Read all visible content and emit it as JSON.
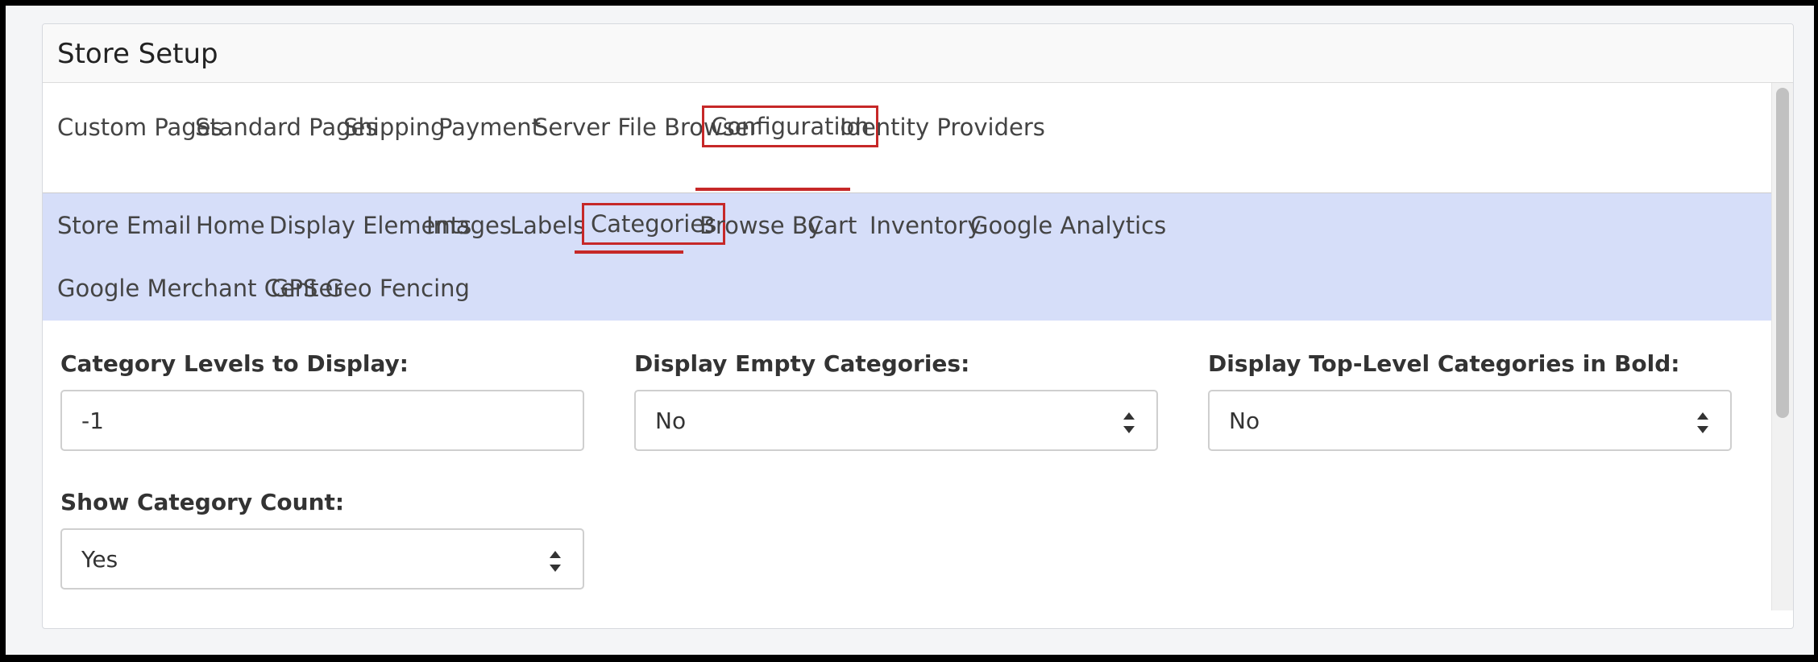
{
  "panel": {
    "title": "Store Setup"
  },
  "primary_tabs": [
    {
      "label": "Custom Pages"
    },
    {
      "label": "Standard Pages"
    },
    {
      "label": "Shipping"
    },
    {
      "label": "Payment"
    },
    {
      "label": "Server File Browser"
    },
    {
      "label": "Configuration",
      "active": true
    },
    {
      "label": "Identity Providers"
    }
  ],
  "sub_tabs": [
    {
      "label": "Store"
    },
    {
      "label": "Email"
    },
    {
      "label": "Home"
    },
    {
      "label": "Display Elements"
    },
    {
      "label": "Images"
    },
    {
      "label": "Labels"
    },
    {
      "label": "Categories",
      "active": true
    },
    {
      "label": "Browse By"
    },
    {
      "label": "Cart"
    },
    {
      "label": "Inventory"
    },
    {
      "label": "Google Analytics"
    },
    {
      "label": "Google Merchant Center"
    },
    {
      "label": "GPS Geo Fencing"
    }
  ],
  "form": {
    "category_levels": {
      "label": "Category Levels to Display:",
      "value": "-1"
    },
    "display_empty": {
      "label": "Display Empty Categories:",
      "value": "No"
    },
    "top_level_bold": {
      "label": "Display Top-Level Categories in Bold:",
      "value": "No"
    },
    "show_count": {
      "label": "Show Category Count:",
      "value": "Yes"
    }
  },
  "colors": {
    "accent": "#c62828",
    "subtab_bg": "#d6def9"
  }
}
